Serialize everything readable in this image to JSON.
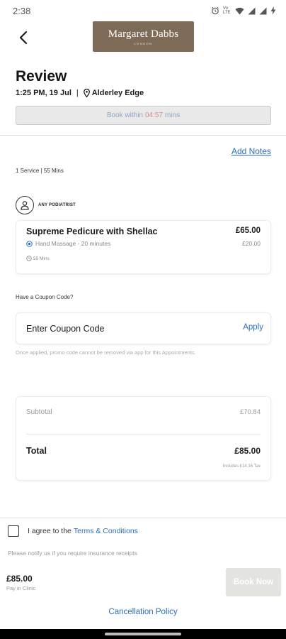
{
  "status_bar": {
    "time": "2:38",
    "volte_label": "Vo LTE",
    "icons": [
      "alarm-icon",
      "wifi-icon",
      "signal-icon",
      "signal-icon",
      "battery-charging-icon"
    ]
  },
  "header": {
    "back_icon": "chevron-left-icon",
    "brand_name": "Margaret Dabbs",
    "brand_sub": "LONDON"
  },
  "review": {
    "title": "Review",
    "datetime": "1:25 PM, 19 Jul",
    "separator": "|",
    "location": "Alderley Edge",
    "timer_prefix": "Book within",
    "timer_countdown": "04:57",
    "timer_suffix": "mins"
  },
  "notes": {
    "add_label": "Add Notes"
  },
  "summary": {
    "text": "1 Service | 55 Mins"
  },
  "staff": {
    "label": "ANY PODIATRIST",
    "icon": "person-icon"
  },
  "service": {
    "name": "Supreme Pedicure with Shellac",
    "price": "£65.00",
    "addon_name": "Hand Massage - 20 minutes",
    "addon_price": "£20.00",
    "duration": "55 Mins"
  },
  "coupon": {
    "heading": "Have a Coupon Code?",
    "placeholder": "Enter Coupon Code",
    "apply_label": "Apply",
    "note": "Once applied, promo code cannot be removed via app for this Appointments."
  },
  "totals": {
    "subtotal_label": "Subtotal",
    "subtotal_value": "£70.84",
    "total_label": "Total",
    "total_value": "£85.00",
    "tax_note": "Includes £14.16 Tax"
  },
  "terms": {
    "prefix": "I agree to the",
    "link": "Terms & Conditions",
    "checked": false
  },
  "insurance_note": "Please notify us if you require insurance receipts",
  "footer": {
    "price": "£85.00",
    "pay_note": "Pay in Clinic",
    "book_label": "Book Now",
    "cancellation_label": "Cancellation Policy"
  },
  "colors": {
    "brand": "#7e6b57",
    "link": "#2a6fb8",
    "countdown": "#d98a8a",
    "disabled_button": "#e3e3e0"
  }
}
